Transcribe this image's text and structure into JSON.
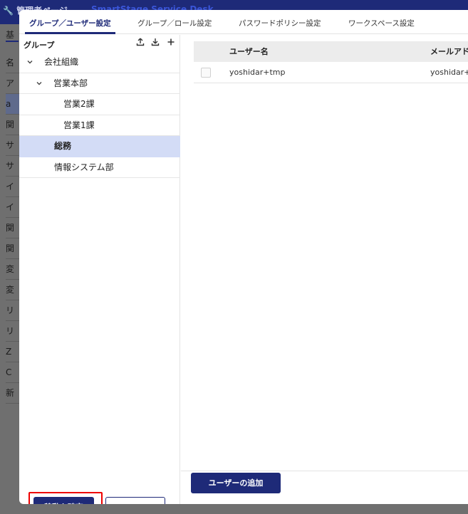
{
  "background": {
    "admin_label": "管理者ページ",
    "app_title": "SmartStage Service Desk",
    "tab_label": "基",
    "rows": [
      "名",
      "ア",
      "a",
      "関",
      "サ",
      "サ",
      "イ",
      "イ",
      "関",
      "関",
      "変",
      "変",
      "リ",
      "リ",
      "Z",
      "C",
      "新"
    ]
  },
  "tabs": [
    {
      "label": "グループ／ユーザー設定"
    },
    {
      "label": "グループ／ロール設定"
    },
    {
      "label": "パスワードポリシー設定"
    },
    {
      "label": "ワークスペース設定"
    }
  ],
  "group_panel": {
    "title": "グループ",
    "icons": [
      "upload-icon",
      "download-icon",
      "plus-icon"
    ],
    "tree": [
      {
        "label": "会社組織",
        "caret": "⌄"
      },
      {
        "label": "営業本部",
        "caret": "⌄"
      },
      {
        "label": "営業2課"
      },
      {
        "label": "営業1課"
      },
      {
        "label": "総務"
      },
      {
        "label": "情報システム部"
      }
    ],
    "confirm_move_label": "移動を確定",
    "cancel_label": "キャンセル"
  },
  "user_panel": {
    "columns": [
      "ユーザー名",
      "メールアド"
    ],
    "rows": [
      {
        "username": "yoshidar+tmp",
        "email": "yoshidar+t"
      }
    ],
    "add_user_label": "ユーザーの追加"
  },
  "colors": {
    "primary": "#1e2a78",
    "selected_row": "#d3dcf6",
    "highlight": "#ee0000"
  }
}
